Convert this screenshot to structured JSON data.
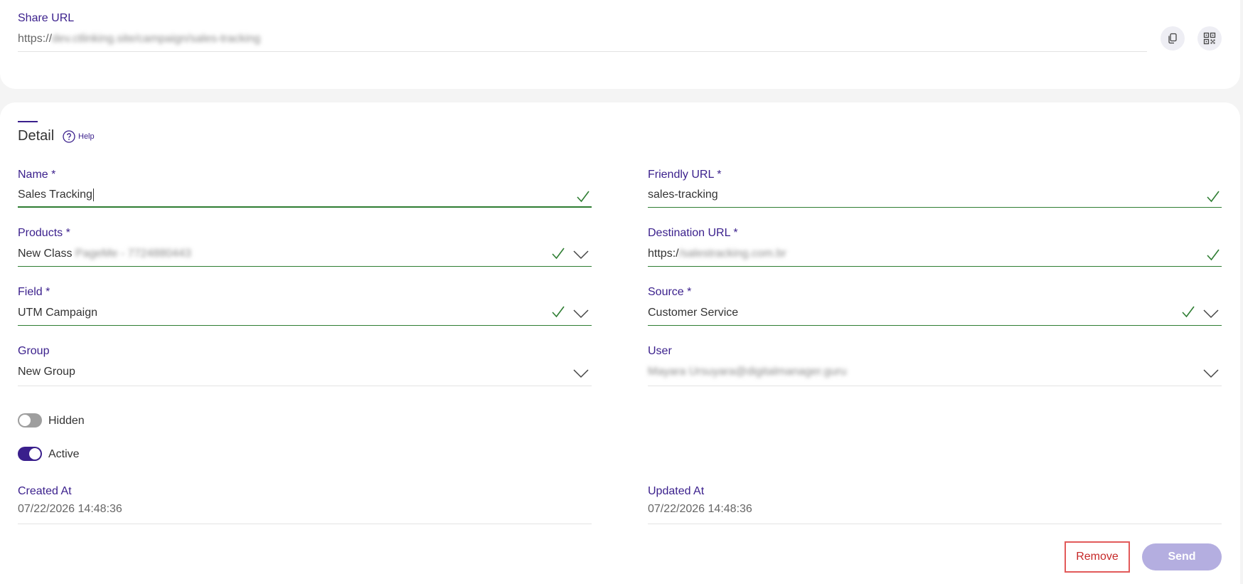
{
  "share": {
    "label": "Share URL",
    "url_prefix": "https://",
    "url_rest": "dev.ctlinking.site/campaign/sales-tracking",
    "copy_icon": "copy-icon",
    "qr_icon": "qr-code-icon"
  },
  "detail": {
    "title": "Detail",
    "help": "Help",
    "fields": {
      "name": {
        "label": "Name *",
        "value": "Sales Tracking"
      },
      "friendly_url": {
        "label": "Friendly URL *",
        "value": "sales-tracking"
      },
      "products": {
        "label": "Products *",
        "value": "New Class",
        "value_hidden": "PageMe - 7724880443"
      },
      "destination_url": {
        "label": "Destination URL *",
        "value": "https:/",
        "value_hidden": "/salestracking.com.br"
      },
      "field": {
        "label": "Field *",
        "value": "UTM Campaign"
      },
      "source": {
        "label": "Source *",
        "value": "Customer Service"
      },
      "group": {
        "label": "Group",
        "value": "New Group"
      },
      "user": {
        "label": "User",
        "value_hidden": "Mayara Ursuyara@digitalmanager.guru"
      }
    },
    "toggles": {
      "hidden": {
        "label": "Hidden",
        "on": false
      },
      "active": {
        "label": "Active",
        "on": true
      }
    },
    "created_at": {
      "label": "Created At",
      "value": "07/22/2026 14:48:36"
    },
    "updated_at": {
      "label": "Updated At",
      "value": "07/22/2026 14:48:36"
    }
  },
  "actions": {
    "remove": "Remove",
    "send": "Send"
  },
  "colors": {
    "accent": "#3a1f8c",
    "valid": "#2e7d32",
    "danger": "#c62828",
    "send_disabled": "#b4aee0"
  }
}
